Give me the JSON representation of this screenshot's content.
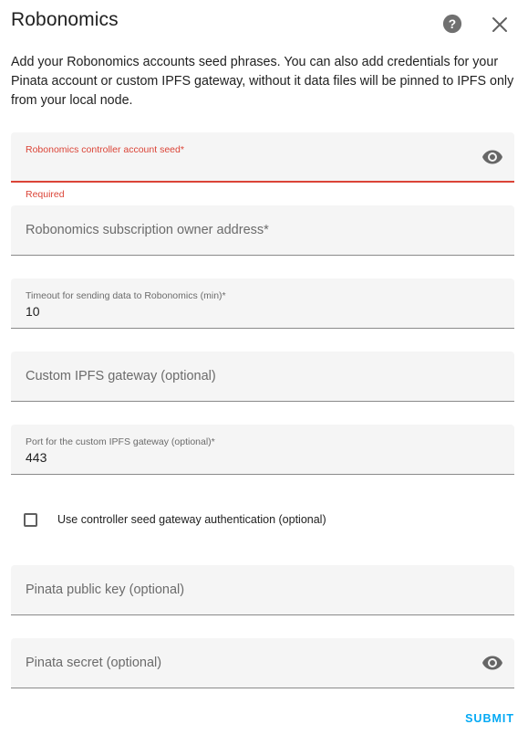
{
  "dialog": {
    "title": "Robonomics",
    "description": "Add your Robonomics accounts seed phrases. You can also add credentials for your Pinata account or custom IPFS gateway, without it data files will be pinned to IPFS only from your local node."
  },
  "fields": {
    "controller_seed": {
      "label": "Robonomics controller account seed*",
      "value": "",
      "error": "Required"
    },
    "owner_address": {
      "label": "Robonomics subscription owner address*",
      "value": ""
    },
    "timeout": {
      "label": "Timeout for sending data to Robonomics (min)*",
      "value": "10"
    },
    "ipfs_gateway": {
      "label": "Custom IPFS gateway (optional)",
      "value": ""
    },
    "ipfs_port": {
      "label": "Port for the custom IPFS gateway (optional)*",
      "value": "443"
    },
    "pinata_public": {
      "label": "Pinata public key (optional)",
      "value": ""
    },
    "pinata_secret": {
      "label": "Pinata secret (optional)",
      "value": ""
    }
  },
  "checkbox": {
    "label": "Use controller seed gateway authentication (optional)",
    "checked": false
  },
  "actions": {
    "submit_label": "SUBMIT"
  },
  "icons": {
    "help": "help-circle-icon",
    "close": "close-icon",
    "eye": "eye-icon"
  },
  "colors": {
    "accent": "#03a9f4",
    "error": "#db4437",
    "field_bg": "#f5f5f5"
  }
}
